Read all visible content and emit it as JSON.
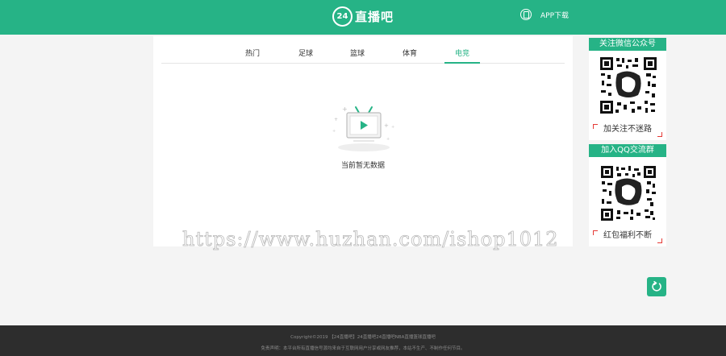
{
  "header": {
    "logo_badge": "24",
    "logo_text": "直播吧",
    "app_download": "APP下载",
    "icons": {
      "app": "phone-icon"
    }
  },
  "tabs": [
    {
      "label": "热门",
      "active": false
    },
    {
      "label": "足球",
      "active": false
    },
    {
      "label": "篮球",
      "active": false
    },
    {
      "label": "体育",
      "active": false
    },
    {
      "label": "电竞",
      "active": true
    }
  ],
  "empty_state": {
    "icon": "tv-play-icon",
    "message": "当前暂无数据"
  },
  "watermark": "https://www.huzhan.com/ishop1012",
  "sidebar": {
    "wechat": {
      "title": "关注微信公众号",
      "caption": "加关注不迷路",
      "icon": "qr-code"
    },
    "qq": {
      "title": "加入QQ交流群",
      "caption": "红包福利不断",
      "icon": "qr-code"
    }
  },
  "refresh": {
    "icon": "refresh-icon"
  },
  "footer": {
    "copyright": "Copyright©2019 【24直播吧】24直播吧24直播吧NBA直播篮球直播吧",
    "disclaimer": "免责声明：本平台所有直播信号源均来自于互联网用户分享或网友推荐，本站不生产、不制作任何节目。"
  },
  "colors": {
    "brand": "#26b386",
    "footer_bg": "#2d2d2d",
    "accent_red": "#e53935"
  }
}
